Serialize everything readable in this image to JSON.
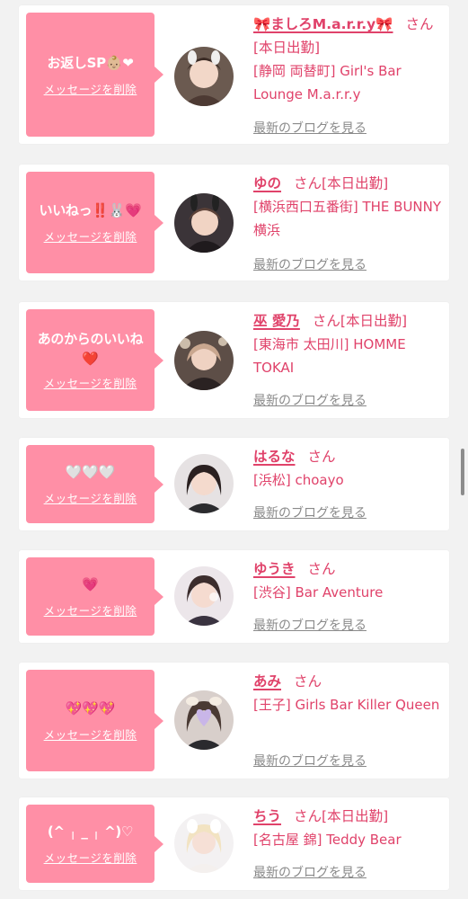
{
  "cards": [
    {
      "message": "お返しSP",
      "message_emoji": "👶🏼❤",
      "delete_label": "メッセージを削除",
      "name": "🎀ましろM.a.r.r.y🎀",
      "san": "さん",
      "status": "",
      "line2": "[本日出勤]",
      "shop": "[静岡 両替町] Girl's Bar Lounge M.a.r.r.y",
      "blog_label": "最新のブログを見る",
      "avatar_icon": "avatar-photo-icon"
    },
    {
      "message": "いいねっ‼️",
      "message_emoji": "🐰💗",
      "delete_label": "メッセージを削除",
      "name": "ゆの",
      "san": "さん",
      "status": "[本日出勤]",
      "shop": "[横浜西口五番街] THE BUNNY横浜",
      "blog_label": "最新のブログを見る",
      "avatar_icon": "avatar-photo-icon"
    },
    {
      "message": "あのからのいいね",
      "message_emoji": "❤️",
      "delete_label": "メッセージを削除",
      "name": "巫 愛乃",
      "san": "さん",
      "status": "[本日出勤]",
      "shop": "[東海市 太田川] HOMME TOKAI",
      "blog_label": "最新のブログを見る",
      "avatar_icon": "avatar-photo-icon"
    },
    {
      "message": "",
      "message_emoji": "🤍🤍🤍",
      "delete_label": "メッセージを削除",
      "name": "はるな",
      "san": "さん",
      "status": "",
      "shop": "[浜松] choayo",
      "blog_label": "最新のブログを見る",
      "avatar_icon": "avatar-photo-icon"
    },
    {
      "message": "",
      "message_emoji": "💗",
      "delete_label": "メッセージを削除",
      "name": "ゆうき",
      "san": "さん",
      "status": "",
      "shop": "[渋谷] Bar Aventure",
      "blog_label": "最新のブログを見る",
      "avatar_icon": "avatar-photo-icon"
    },
    {
      "message": "",
      "message_emoji": "💖💖💖",
      "delete_label": "メッセージを削除",
      "name": "あみ",
      "san": "さん",
      "status": "",
      "shop": "[王子] Girls Bar Killer Queen",
      "blog_label": "最新のブログを見る",
      "avatar_icon": "avatar-photo-icon"
    },
    {
      "message": "(^ ╷ _ ╷ ^)♡",
      "message_emoji": "",
      "delete_label": "メッセージを削除",
      "name": "ちう",
      "san": "さん",
      "status": "[本日出勤]",
      "shop": "[名古屋 錦] Teddy Bear",
      "blog_label": "最新のブログを見る",
      "avatar_icon": "avatar-photo-icon"
    }
  ],
  "colors": {
    "page_bg": "#f2f2f2",
    "card_bg": "#ffffff",
    "bubble_bg": "#ff8fa6",
    "accent_pink": "#e0426a",
    "link_gray": "#8a8a8a"
  }
}
